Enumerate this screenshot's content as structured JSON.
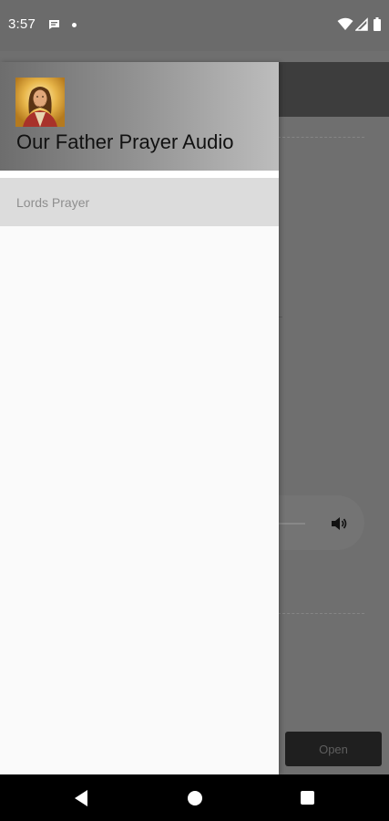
{
  "status_bar": {
    "time": "3:57",
    "icons": [
      "message-icon",
      "notification-dot-icon",
      "wifi-icon",
      "signal-icon",
      "battery-icon"
    ]
  },
  "drawer": {
    "title": "Our Father Prayer Audio",
    "avatar_icon": "jesus-portrait-icon",
    "items": [
      {
        "label": "Lords Prayer"
      }
    ]
  },
  "background_app": {
    "open_button_label": "Open",
    "volume_icon": "volume-icon"
  },
  "nav_bar": {
    "icons": [
      "back-icon",
      "home-icon",
      "recents-icon"
    ]
  },
  "colors": {
    "drawer_header_gradient_start": "#6d6d6d",
    "drawer_header_gradient_end": "#bdbdbd",
    "selected_item_background": "#dcdcdc",
    "scrim": "#6e6e6e"
  }
}
